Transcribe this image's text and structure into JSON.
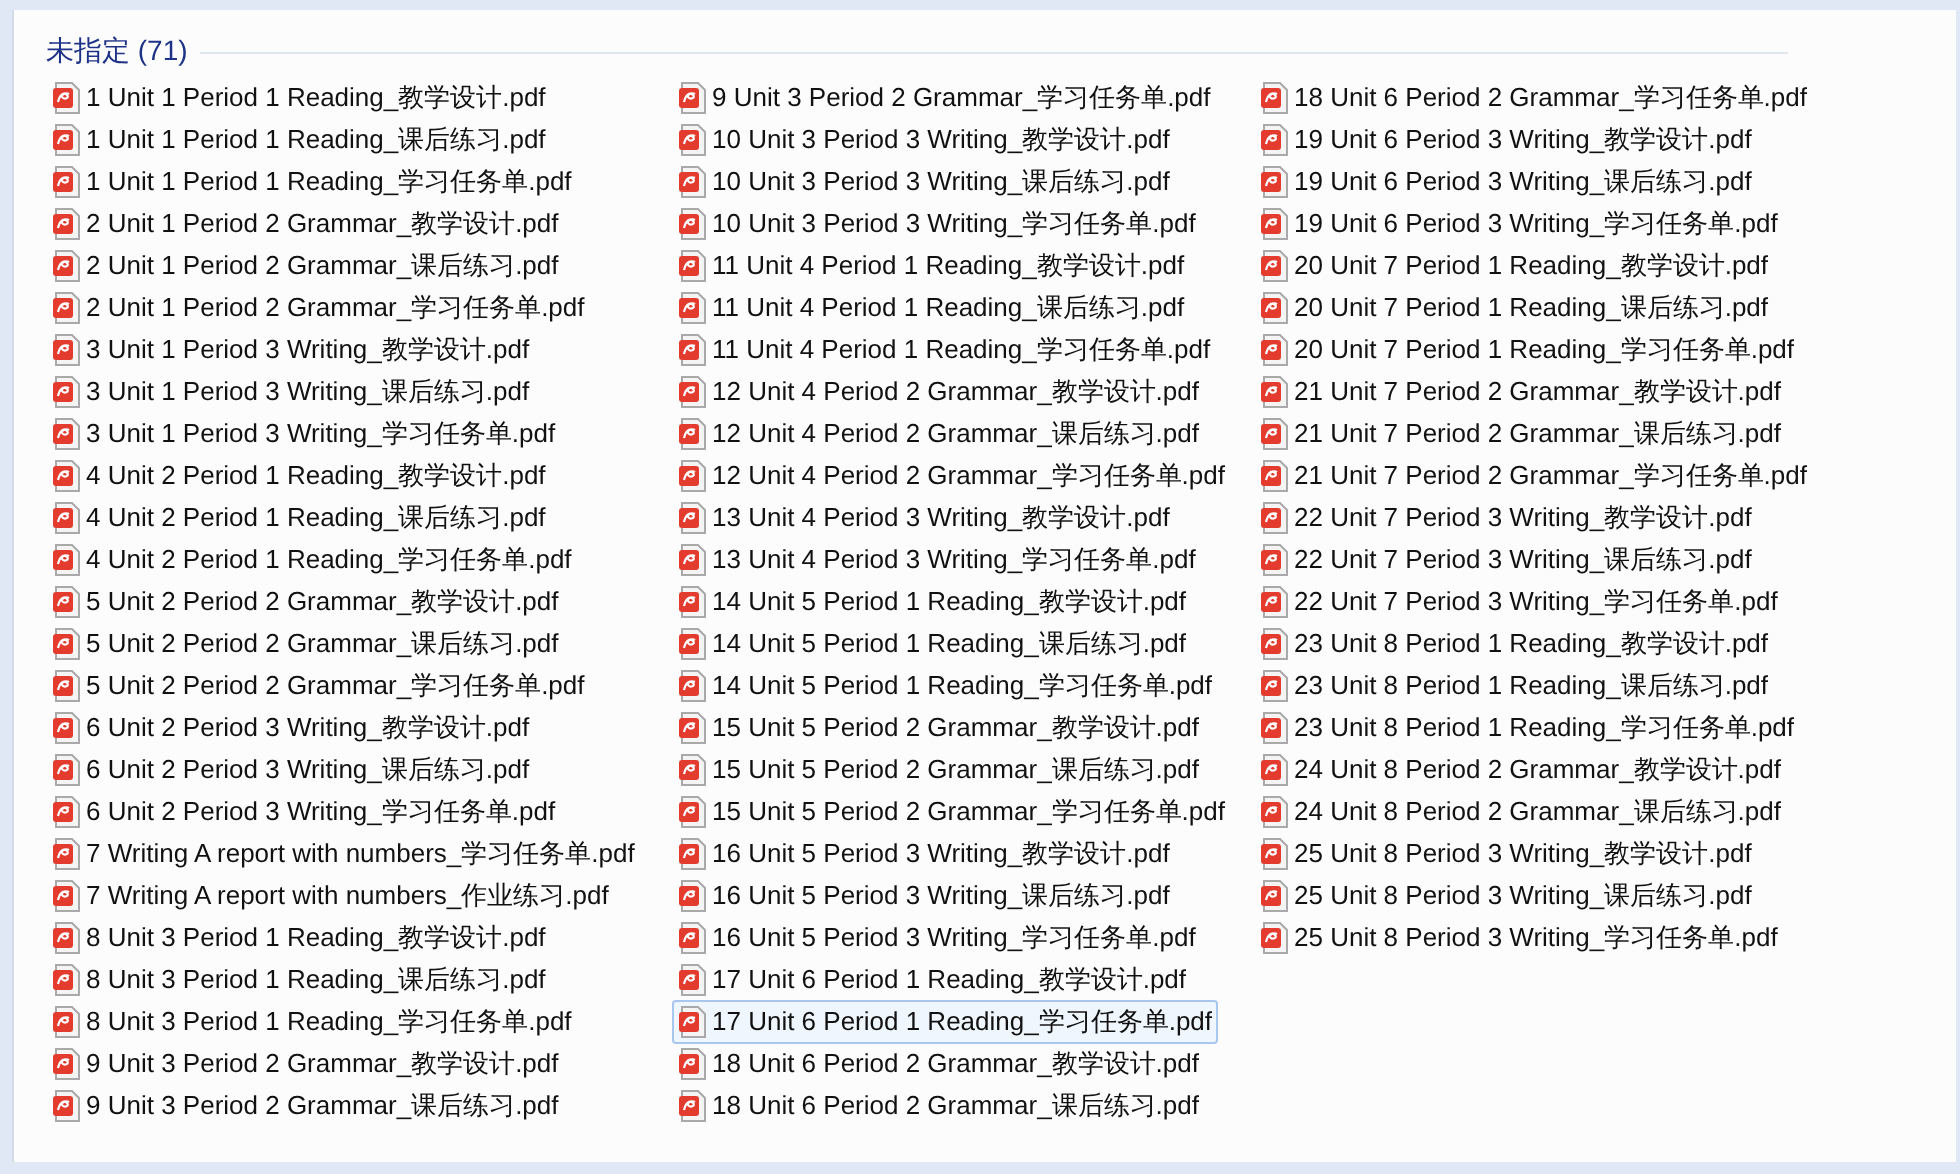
{
  "group": {
    "title": "未指定 (71)"
  },
  "files": [
    {
      "name": "1 Unit 1 Period 1 Reading_教学设计.pdf",
      "selected": false
    },
    {
      "name": "1 Unit 1 Period 1 Reading_课后练习.pdf",
      "selected": false
    },
    {
      "name": "1 Unit 1 Period 1 Reading_学习任务单.pdf",
      "selected": false
    },
    {
      "name": "2 Unit 1 Period 2 Grammar_教学设计.pdf",
      "selected": false
    },
    {
      "name": "2 Unit 1 Period 2 Grammar_课后练习.pdf",
      "selected": false
    },
    {
      "name": "2 Unit 1 Period 2 Grammar_学习任务单.pdf",
      "selected": false
    },
    {
      "name": "3 Unit 1 Period 3 Writing_教学设计.pdf",
      "selected": false
    },
    {
      "name": "3 Unit 1 Period 3 Writing_课后练习.pdf",
      "selected": false
    },
    {
      "name": "3 Unit 1 Period 3 Writing_学习任务单.pdf",
      "selected": false
    },
    {
      "name": "4 Unit 2 Period 1 Reading_教学设计.pdf",
      "selected": false
    },
    {
      "name": "4 Unit 2 Period 1 Reading_课后练习.pdf",
      "selected": false
    },
    {
      "name": "4 Unit 2 Period 1 Reading_学习任务单.pdf",
      "selected": false
    },
    {
      "name": "5 Unit 2 Period 2 Grammar_教学设计.pdf",
      "selected": false
    },
    {
      "name": "5 Unit 2 Period 2 Grammar_课后练习.pdf",
      "selected": false
    },
    {
      "name": "5 Unit 2 Period 2 Grammar_学习任务单.pdf",
      "selected": false
    },
    {
      "name": "6 Unit 2 Period 3 Writing_教学设计.pdf",
      "selected": false
    },
    {
      "name": "6 Unit 2 Period 3 Writing_课后练习.pdf",
      "selected": false
    },
    {
      "name": "6 Unit 2 Period 3 Writing_学习任务单.pdf",
      "selected": false
    },
    {
      "name": "7 Writing A report with numbers_学习任务单.pdf",
      "selected": false
    },
    {
      "name": "7 Writing A report with numbers_作业练习.pdf",
      "selected": false
    },
    {
      "name": "8 Unit 3 Period 1 Reading_教学设计.pdf",
      "selected": false
    },
    {
      "name": "8 Unit 3 Period 1 Reading_课后练习.pdf",
      "selected": false
    },
    {
      "name": "8 Unit 3 Period 1 Reading_学习任务单.pdf",
      "selected": false
    },
    {
      "name": "9 Unit 3 Period 2 Grammar_教学设计.pdf",
      "selected": false
    },
    {
      "name": "9 Unit 3 Period 2 Grammar_课后练习.pdf",
      "selected": false
    },
    {
      "name": "9 Unit 3 Period 2 Grammar_学习任务单.pdf",
      "selected": false
    },
    {
      "name": "10 Unit 3 Period 3 Writing_教学设计.pdf",
      "selected": false
    },
    {
      "name": "10 Unit 3 Period 3 Writing_课后练习.pdf",
      "selected": false
    },
    {
      "name": "10 Unit 3 Period 3 Writing_学习任务单.pdf",
      "selected": false
    },
    {
      "name": "11 Unit 4 Period 1 Reading_教学设计.pdf",
      "selected": false
    },
    {
      "name": "11 Unit 4 Period 1 Reading_课后练习.pdf",
      "selected": false
    },
    {
      "name": "11 Unit 4 Period 1 Reading_学习任务单.pdf",
      "selected": false
    },
    {
      "name": "12 Unit 4 Period 2 Grammar_教学设计.pdf",
      "selected": false
    },
    {
      "name": "12 Unit 4 Period 2 Grammar_课后练习.pdf",
      "selected": false
    },
    {
      "name": "12 Unit 4 Period 2 Grammar_学习任务单.pdf",
      "selected": false
    },
    {
      "name": "13 Unit 4 Period 3 Writing_教学设计.pdf",
      "selected": false
    },
    {
      "name": "13 Unit 4 Period 3 Writing_学习任务单.pdf",
      "selected": false
    },
    {
      "name": "14 Unit 5 Period 1 Reading_教学设计.pdf",
      "selected": false
    },
    {
      "name": "14 Unit 5 Period 1 Reading_课后练习.pdf",
      "selected": false
    },
    {
      "name": "14 Unit 5 Period 1 Reading_学习任务单.pdf",
      "selected": false
    },
    {
      "name": "15 Unit 5 Period 2 Grammar_教学设计.pdf",
      "selected": false
    },
    {
      "name": "15 Unit 5 Period 2 Grammar_课后练习.pdf",
      "selected": false
    },
    {
      "name": "15 Unit 5 Period 2 Grammar_学习任务单.pdf",
      "selected": false
    },
    {
      "name": "16 Unit 5 Period 3 Writing_教学设计.pdf",
      "selected": false
    },
    {
      "name": "16 Unit 5 Period 3 Writing_课后练习.pdf",
      "selected": false
    },
    {
      "name": "16 Unit 5 Period 3 Writing_学习任务单.pdf",
      "selected": false
    },
    {
      "name": "17 Unit 6 Period 1 Reading_教学设计.pdf",
      "selected": false
    },
    {
      "name": "17 Unit 6 Period 1 Reading_学习任务单.pdf",
      "selected": true
    },
    {
      "name": "18 Unit 6 Period 2 Grammar_教学设计.pdf",
      "selected": false
    },
    {
      "name": "18 Unit 6 Period 2 Grammar_课后练习.pdf",
      "selected": false
    },
    {
      "name": "18 Unit 6 Period 2 Grammar_学习任务单.pdf",
      "selected": false
    },
    {
      "name": "19 Unit 6 Period 3 Writing_教学设计.pdf",
      "selected": false
    },
    {
      "name": "19 Unit 6 Period 3 Writing_课后练习.pdf",
      "selected": false
    },
    {
      "name": "19 Unit 6 Period 3 Writing_学习任务单.pdf",
      "selected": false
    },
    {
      "name": "20 Unit 7 Period 1 Reading_教学设计.pdf",
      "selected": false
    },
    {
      "name": "20 Unit 7 Period 1 Reading_课后练习.pdf",
      "selected": false
    },
    {
      "name": "20 Unit 7 Period 1 Reading_学习任务单.pdf",
      "selected": false
    },
    {
      "name": "21 Unit 7 Period 2 Grammar_教学设计.pdf",
      "selected": false
    },
    {
      "name": "21 Unit 7 Period 2 Grammar_课后练习.pdf",
      "selected": false
    },
    {
      "name": "21 Unit 7 Period 2 Grammar_学习任务单.pdf",
      "selected": false
    },
    {
      "name": "22 Unit 7 Period 3 Writing_教学设计.pdf",
      "selected": false
    },
    {
      "name": "22 Unit 7 Period 3 Writing_课后练习.pdf",
      "selected": false
    },
    {
      "name": "22 Unit 7 Period 3 Writing_学习任务单.pdf",
      "selected": false
    },
    {
      "name": "23 Unit 8 Period 1 Reading_教学设计.pdf",
      "selected": false
    },
    {
      "name": "23 Unit 8 Period 1 Reading_课后练习.pdf",
      "selected": false
    },
    {
      "name": "23 Unit 8 Period 1 Reading_学习任务单.pdf",
      "selected": false
    },
    {
      "name": "24 Unit 8 Period 2 Grammar_教学设计.pdf",
      "selected": false
    },
    {
      "name": "24 Unit 8 Period 2 Grammar_课后练习.pdf",
      "selected": false
    },
    {
      "name": "25 Unit 8 Period 3 Writing_教学设计.pdf",
      "selected": false
    },
    {
      "name": "25 Unit 8 Period 3 Writing_课后练习.pdf",
      "selected": false
    },
    {
      "name": "25 Unit 8 Period 3 Writing_学习任务单.pdf",
      "selected": false
    }
  ]
}
